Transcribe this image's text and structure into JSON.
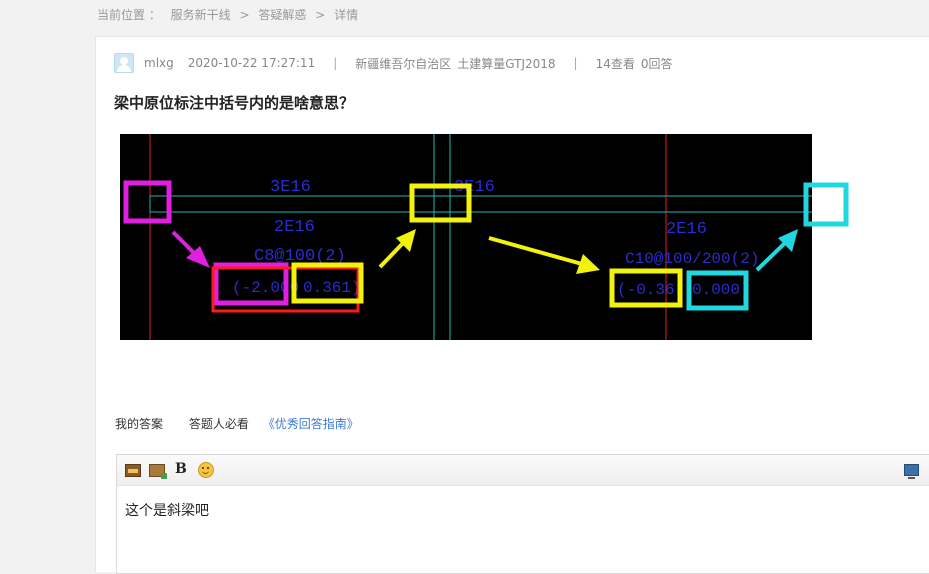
{
  "breadcrumb": {
    "label": "当前位置 ：",
    "items": [
      "服务新干线",
      "答疑解惑",
      "详情"
    ],
    "separator": ">"
  },
  "question": {
    "user": "mlxg",
    "datetime": "2020-10-22 17:27:11",
    "region": "新疆维吾尔自治区",
    "software": "土建算量GTJ2018",
    "views": "14查看",
    "answers": "0回答",
    "title": "梁中原位标注中括号内的是啥意思？"
  },
  "drawing": {
    "labels": {
      "rebar_top_left": "3E16",
      "rebar_top_right": "3E16",
      "rebar_mid_left": "2E16",
      "stirrup_left": "C8@100(2)",
      "offset_left_1": "(-2.000",
      "offset_left_2": "0.361)",
      "rebar_mid_right": "2E16",
      "stirrup_right": "C10@100/200(2)",
      "offset_right_1": "(-0.36",
      "offset_right_2": "0.000)"
    },
    "colors": {
      "background": "#000000",
      "grid_line": "#1fb5b5",
      "axis_line": "#e02020",
      "text": "#2b2bd0",
      "magenta": "#e020e0",
      "yellow": "#f2f20a",
      "cyan": "#20d8e0",
      "red_box": "#ff1a1a"
    }
  },
  "answer": {
    "my_answer": "我的答案",
    "must_read": "答题人必看",
    "guide_link": "《优秀回答指南》",
    "editor_text": "这个是斜梁吧"
  },
  "toolbar": {
    "icons": [
      "insert-image-icon",
      "upload-image-icon",
      "bold-icon",
      "emoji-icon",
      "fullscreen-icon"
    ]
  }
}
